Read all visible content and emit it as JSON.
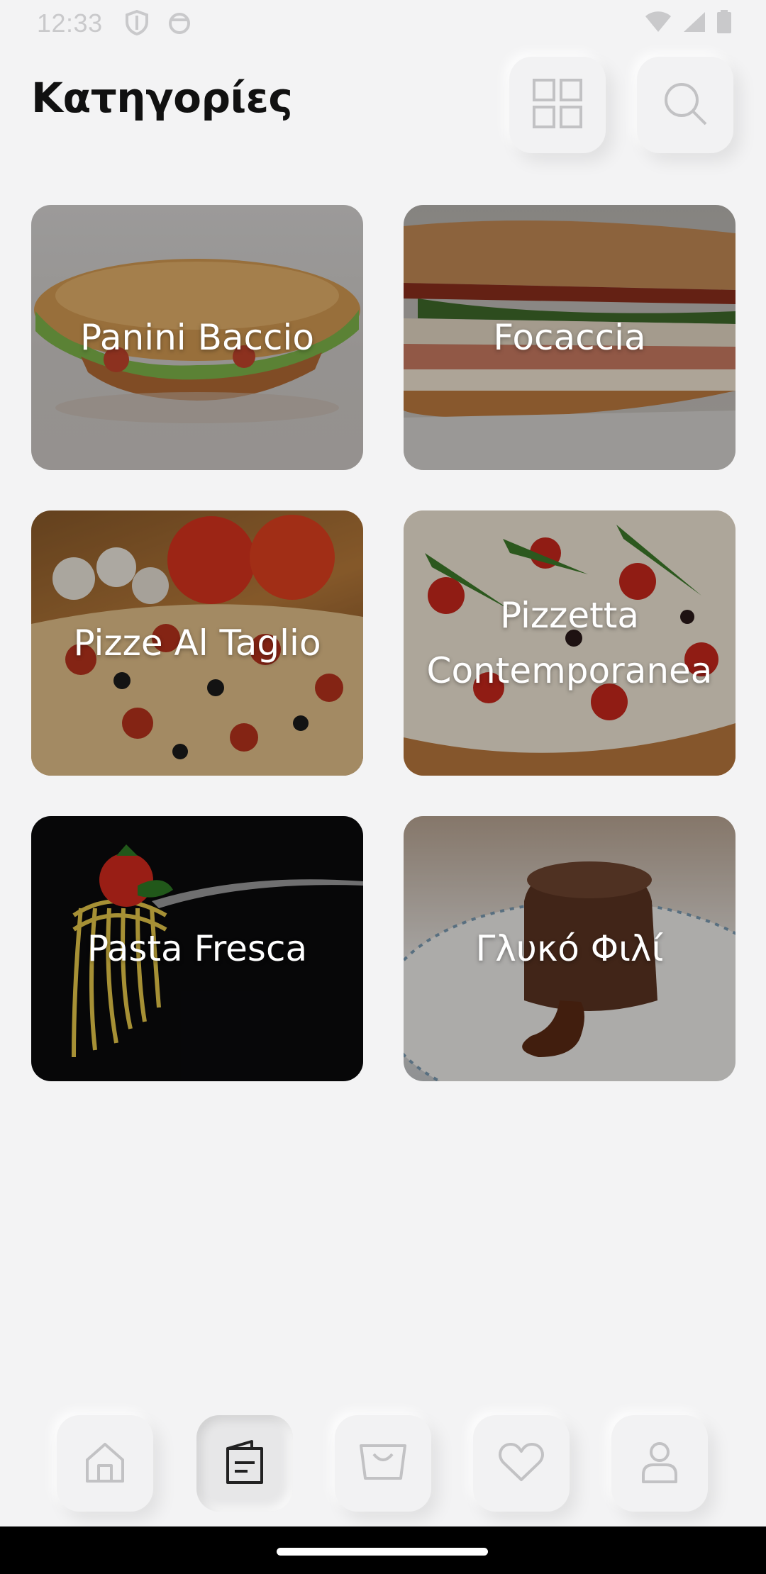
{
  "status_bar": {
    "time": "12:33"
  },
  "header": {
    "title": "Κατηγορίες"
  },
  "categories": [
    {
      "label": "Panini Baccio"
    },
    {
      "label": "Focaccia"
    },
    {
      "label": "Pizze Al Taglio"
    },
    {
      "label": "Pizzetta Contemporanea"
    },
    {
      "label": "Pasta Fresca"
    },
    {
      "label": "Γλυκό Φιλί"
    }
  ],
  "bottom_nav": {
    "items": [
      "home-icon",
      "menu-icon",
      "basket-icon",
      "heart-icon",
      "profile-icon"
    ],
    "active_index": 1
  },
  "colors": {
    "background": "#f3f3f4",
    "title": "#111111",
    "icon": "#c2c2c4",
    "active_icon": "#222222"
  }
}
